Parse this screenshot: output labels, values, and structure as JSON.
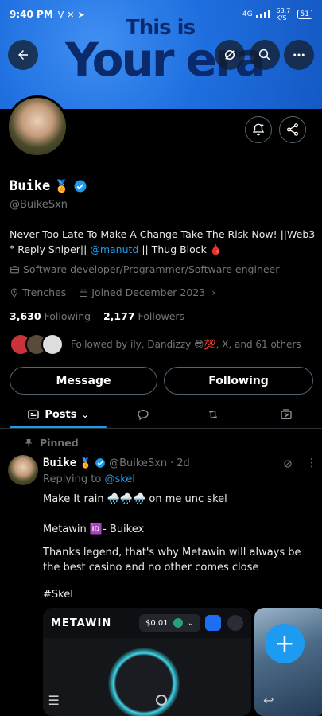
{
  "status": {
    "time": "9:40 PM",
    "app_icons": [
      "V",
      "✕",
      "➤"
    ],
    "network": "4G",
    "speed": "63.7 K/S",
    "battery": "51"
  },
  "banner": {
    "line1": "This is",
    "line2": "Your era"
  },
  "profile": {
    "name": "Buike",
    "badge_emoji": "🏅",
    "handle": "@BuikeSxn",
    "bio_part1": "Never Too Late To Make A Change Take The Risk Now! ||Web3 ° Reply Sniper|| ",
    "bio_link": "@manutd",
    "bio_part2": " || Thug Block 🩸",
    "category": "Software developer/Programmer/Software engineer",
    "location": "Trenches",
    "joined": "Joined December 2023",
    "following_count": "3,630",
    "following_label": "Following",
    "followers_count": "2,177",
    "followers_label": "Followers",
    "followed_by": "Followed by ily, Dandizzy 😎💯, X, and 61 others"
  },
  "actions": {
    "message": "Message",
    "following": "Following"
  },
  "tabs": {
    "posts": "Posts"
  },
  "post": {
    "pinned_label": "Pinned",
    "name": "Buike",
    "badge_emoji": "🏅",
    "handle": "@BuikeSxn",
    "dot": "·",
    "time": "2d",
    "replying_prefix": "Replying to ",
    "replying_to": "@skel",
    "line1": "Make It rain 🌧️🌧️🌧️ on me unc skel",
    "line2": "Metawin 🆔- Buikex",
    "line3": "Thanks legend, that's why Metawin will always be the best casino and no other comes close",
    "hashtag": "#Skel",
    "media_logo": "METAWIN",
    "media_balance": "$0.01"
  },
  "colors": {
    "accent": "#1d9bf0",
    "background": "#000000",
    "banner": "#1f6fe0"
  }
}
